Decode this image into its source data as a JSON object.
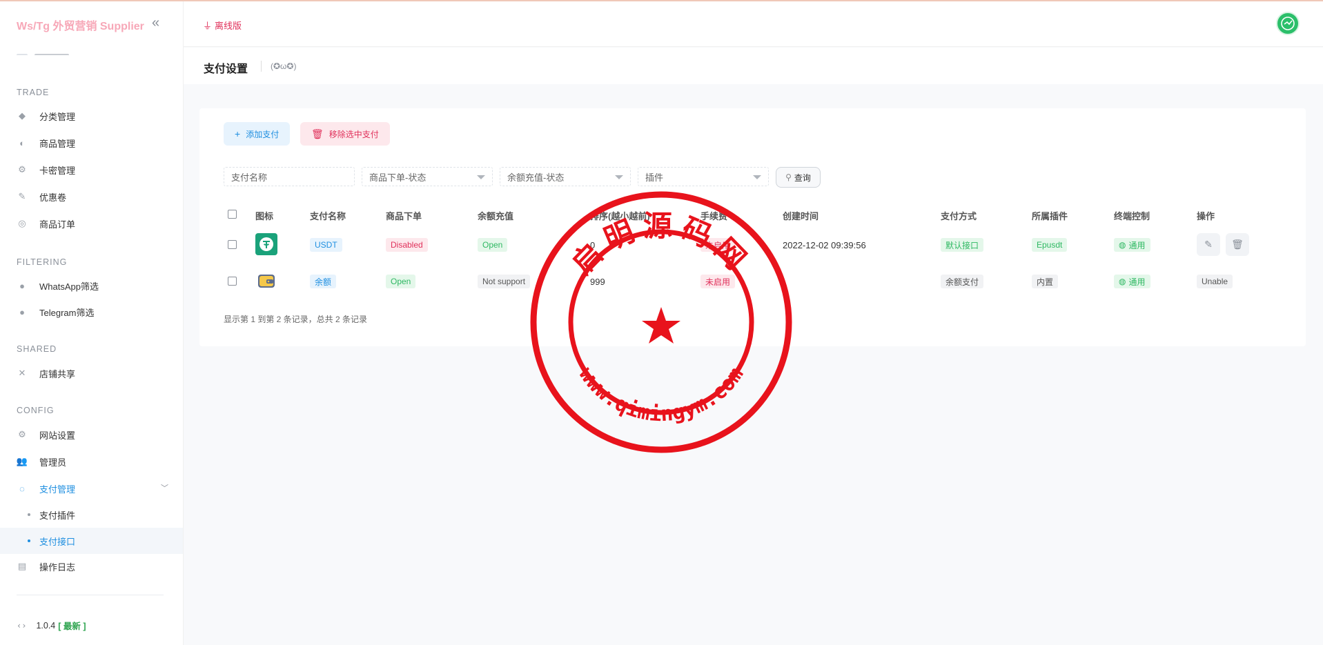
{
  "sidebar": {
    "brand": "Ws/Tg 外贸营销 Supplier",
    "sections": {
      "trade": "TRADE",
      "filtering": "FILTERING",
      "shared": "SHARED",
      "config": "CONFIG"
    },
    "items": {
      "category": "分类管理",
      "goods": "商品管理",
      "cardkey": "卡密管理",
      "coupon": "优惠卷",
      "orders": "商品订单",
      "whatsapp": "WhatsApp筛选",
      "telegram": "Telegram筛选",
      "shop_share": "店铺共享",
      "site_settings": "网站设置",
      "admins": "管理员",
      "payment_mgmt": "支付管理",
      "payment_plugins": "支付插件",
      "payment_api": "支付接口",
      "operation_log": "操作日志"
    },
    "version": "1.0.4",
    "version_tag": "[ 最新 ]"
  },
  "header": {
    "offline_label": "离线版"
  },
  "page": {
    "title": "支付设置",
    "face": "(✪ω✪)"
  },
  "toolbar": {
    "add_label": "添加支付",
    "remove_label": "移除选中支付"
  },
  "filters": {
    "name_placeholder": "支付名称",
    "order_status": "商品下单-状态",
    "recharge_status": "余额充值-状态",
    "plugin": "插件",
    "search_label": "查询"
  },
  "table": {
    "headers": [
      "图标",
      "支付名称",
      "商品下单",
      "余额充值",
      "排序(越小越前)",
      "手续费",
      "创建时间",
      "支付方式",
      "所属插件",
      "终端控制",
      "操作"
    ],
    "rows": [
      {
        "name": "USDT",
        "order": "Disabled",
        "recharge": "Open",
        "sort": "0",
        "fee": "未启用",
        "created": "2022-12-02 09:39:56",
        "method": "默认接口",
        "plugin": "Epusdt",
        "terminal": "通用"
      },
      {
        "name": "余额",
        "order": "Open",
        "recharge": "Not support",
        "sort": "999",
        "fee": "未启用",
        "created": "-",
        "method": "余额支付",
        "plugin": "内置",
        "terminal": "通用",
        "action": "Unable"
      }
    ],
    "footer": "显示第 1 到第 2 条记录，总共 2 条记录"
  },
  "watermark": {
    "top_text": "启明源码网",
    "bottom_text": "www.qimingym.com"
  },
  "colors": {
    "primary": "#1f8fe0",
    "danger": "#e0305a",
    "success": "#2eb862",
    "brand_pink": "#f7a8b8",
    "stamp_red": "#e8131c"
  }
}
